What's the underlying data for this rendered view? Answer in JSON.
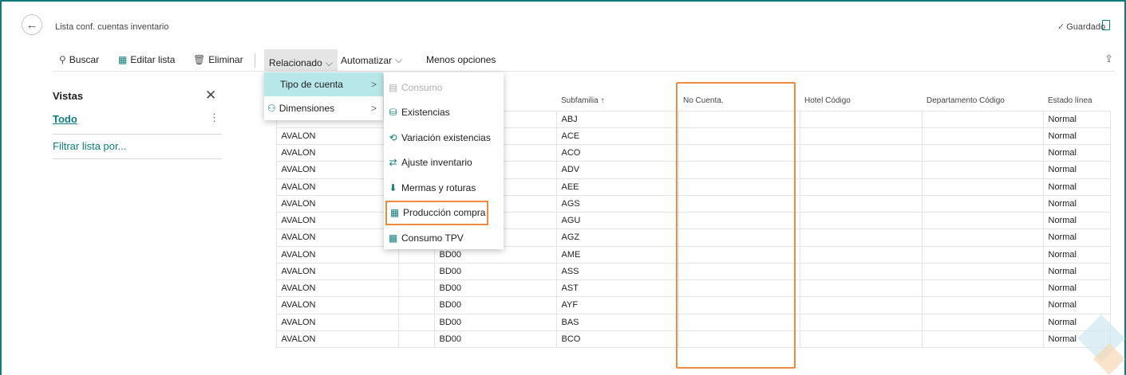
{
  "header": {
    "title": "Lista conf. cuentas inventario",
    "saved_label": "Guardado"
  },
  "actions": {
    "buscar": "Buscar",
    "editar": "Editar lista",
    "eliminar": "Eliminar",
    "relacionado": "Relacionado",
    "automatizar": "Automatizar",
    "menos": "Menos opciones"
  },
  "views": {
    "heading": "Vistas",
    "todo": "Todo",
    "filter": "Filtrar lista por..."
  },
  "table": {
    "columns": [
      "",
      "",
      "",
      "Subfamilia ↑",
      "No Cuenta.",
      "Hotel Código",
      "Departamento Código",
      "Estado línea"
    ],
    "rows": [
      [
        "",
        "",
        "",
        "ABJ",
        "",
        "",
        "",
        "Normal"
      ],
      [
        "AVALON",
        "",
        "",
        "ACE",
        "",
        "",
        "",
        "Normal"
      ],
      [
        "AVALON",
        "",
        "",
        "ACO",
        "",
        "",
        "",
        "Normal"
      ],
      [
        "AVALON",
        "",
        "",
        "ADV",
        "",
        "",
        "",
        "Normal"
      ],
      [
        "AVALON",
        "",
        "",
        "AEE",
        "",
        "",
        "",
        "Normal"
      ],
      [
        "AVALON",
        "",
        "",
        "AGS",
        "",
        "",
        "",
        "Normal"
      ],
      [
        "AVALON",
        "",
        "",
        "AGU",
        "",
        "",
        "",
        "Normal"
      ],
      [
        "AVALON",
        "",
        "BD00",
        "AGZ",
        "",
        "",
        "",
        "Normal"
      ],
      [
        "AVALON",
        "",
        "BD00",
        "AME",
        "",
        "",
        "",
        "Normal"
      ],
      [
        "AVALON",
        "",
        "BD00",
        "ASS",
        "",
        "",
        "",
        "Normal"
      ],
      [
        "AVALON",
        "",
        "BD00",
        "AST",
        "",
        "",
        "",
        "Normal"
      ],
      [
        "AVALON",
        "",
        "BD00",
        "AYF",
        "",
        "",
        "",
        "Normal"
      ],
      [
        "AVALON",
        "",
        "BD00",
        "BAS",
        "",
        "",
        "",
        "Normal"
      ],
      [
        "AVALON",
        "",
        "BD00",
        "BCO",
        "",
        "",
        "",
        "Normal"
      ]
    ]
  },
  "menu_related": {
    "items": [
      "Tipo de cuenta",
      "Dimensiones"
    ]
  },
  "menu_account_type": {
    "items": [
      {
        "label": "Consumo",
        "icon": "consumo-icon",
        "disabled": true
      },
      {
        "label": "Existencias",
        "icon": "existencias-icon",
        "disabled": false
      },
      {
        "label": "Variación existencias",
        "icon": "variacion-icon",
        "disabled": false
      },
      {
        "label": "Ajuste inventario",
        "icon": "ajuste-icon",
        "disabled": false
      },
      {
        "label": "Mermas y roturas",
        "icon": "arrow-down-icon",
        "disabled": false
      },
      {
        "label": "Producción compra",
        "icon": "produccion-icon",
        "disabled": false
      },
      {
        "label": "Consumo TPV",
        "icon": "calculator-icon",
        "disabled": false
      }
    ]
  },
  "colors": {
    "accent": "#0f7b7b",
    "highlight": "#f08a3c",
    "menu_active": "#b8e7ea"
  }
}
